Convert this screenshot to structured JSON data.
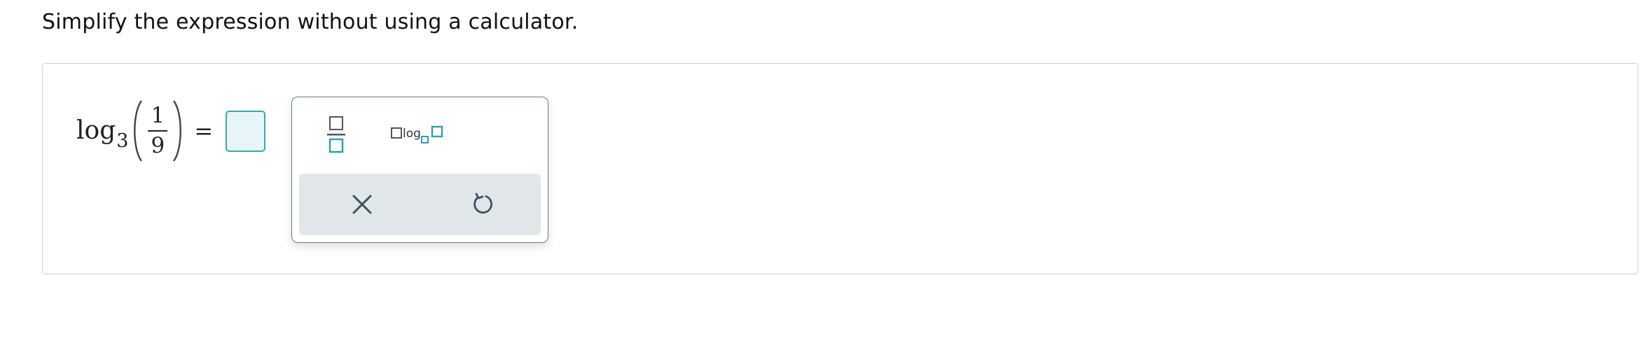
{
  "question": {
    "prompt": "Simplify the expression without using a calculator."
  },
  "equation": {
    "function": "log",
    "base": "3",
    "numerator": "1",
    "denominator": "9",
    "equals": "=",
    "answer_value": ""
  },
  "palette": {
    "logbase_label": "log",
    "accent_color": "#2ba3a8",
    "border_color": "#5f7f8c",
    "action_bar_color": "#e1e7e9"
  },
  "icons": {
    "fraction": "fraction-template-icon",
    "log_base": "log-base-template-icon",
    "clear": "close-icon",
    "undo": "undo-icon"
  }
}
